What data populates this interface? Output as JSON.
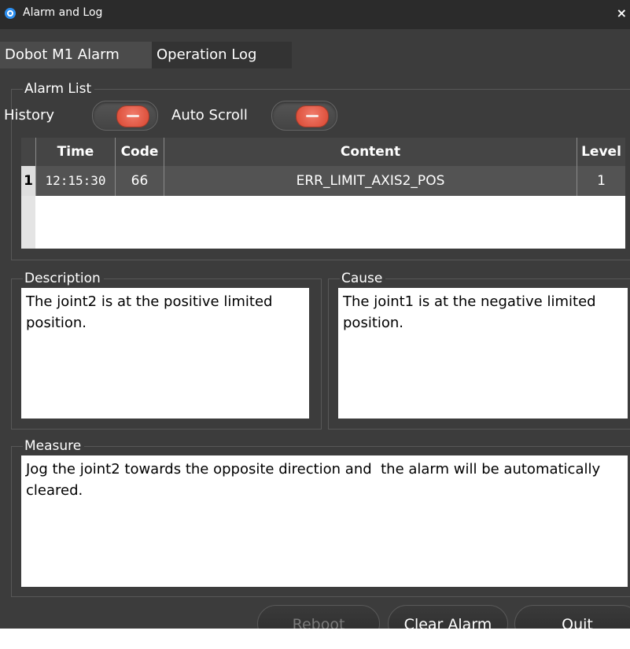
{
  "window": {
    "title": "Alarm and Log",
    "close_label": "×"
  },
  "tabs": [
    {
      "label": "Dobot M1 Alarm",
      "active": true
    },
    {
      "label": "Operation Log",
      "active": false
    }
  ],
  "alarm_list": {
    "group_label": "Alarm List",
    "history_label": "History",
    "history_on": false,
    "auto_scroll_label": "Auto Scroll",
    "auto_scroll_on": false,
    "columns": [
      "Time",
      "Code",
      "Content",
      "Level"
    ],
    "rows": [
      {
        "index": "1",
        "time": "12:15:30",
        "code": "66",
        "content": "ERR_LIMIT_AXIS2_POS",
        "level": "1"
      }
    ]
  },
  "description": {
    "label": "Description",
    "text": "The joint2 is at the positive limited position."
  },
  "cause": {
    "label": "Cause",
    "text": "The joint1 is at the negative limited position."
  },
  "measure": {
    "label": "Measure",
    "text": "Jog the joint2 towards the opposite direction and  the alarm will be automatically cleared."
  },
  "buttons": {
    "reboot": "Reboot",
    "clear_alarm": "Clear Alarm",
    "quit": "Quit"
  },
  "colors": {
    "background": "#3c3c3c",
    "title_bar": "#2b2b2b",
    "toggle_knob": "#d9452f",
    "app_icon": "#2c8ff0"
  }
}
